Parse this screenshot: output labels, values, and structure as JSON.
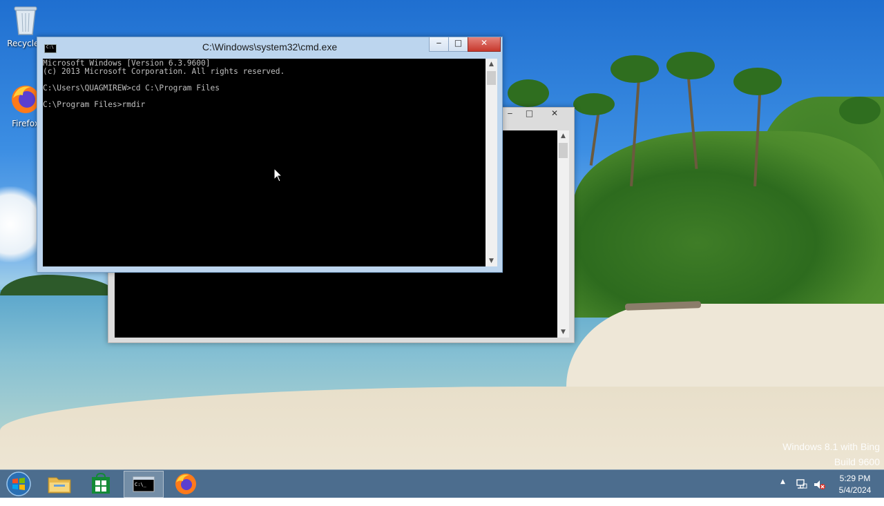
{
  "desktop": {
    "icons": [
      {
        "label": "Recycle I",
        "icon": "recycle-bin-icon"
      },
      {
        "label": "Firefox",
        "icon": "firefox-icon"
      }
    ],
    "watermark": {
      "line1": "Windows 8.1 with Bing",
      "line2": "Build 9600"
    }
  },
  "windows": {
    "front": {
      "title": "C:\\Windows\\system32\\cmd.exe",
      "console_text": "Microsoft Windows [Version 6.3.9600]\n(c) 2013 Microsoft Corporation. All rights reserved.\n\nC:\\Users\\QUAGMIREW>cd C:\\Program Files\n\nC:\\Program Files>rmdir",
      "controls": {
        "minimize": "‒",
        "maximize": "□",
        "close": "✕"
      }
    },
    "back": {
      "title": "",
      "console_text": "",
      "controls": {
        "minimize": "‒",
        "maximize": "□",
        "close": "✕"
      }
    }
  },
  "taskbar": {
    "buttons": [
      {
        "name": "start",
        "icon": "windows-start-icon"
      },
      {
        "name": "file-explorer",
        "icon": "folder-icon"
      },
      {
        "name": "store",
        "icon": "store-icon"
      },
      {
        "name": "command-prompt",
        "icon": "cmd-icon",
        "active": true
      },
      {
        "name": "firefox",
        "icon": "firefox-icon"
      }
    ],
    "tray": {
      "chevron": "▲",
      "icons": [
        "network-icon",
        "volume-muted-icon"
      ]
    },
    "clock": {
      "time": "5:29 PM",
      "date": "5/4/2024"
    }
  },
  "colors": {
    "taskbar": "#3e6388",
    "console_bg": "#000000",
    "console_fg": "#c0c0c0",
    "active_frame": "#bcd5ee",
    "close_button": "#c7382c"
  }
}
